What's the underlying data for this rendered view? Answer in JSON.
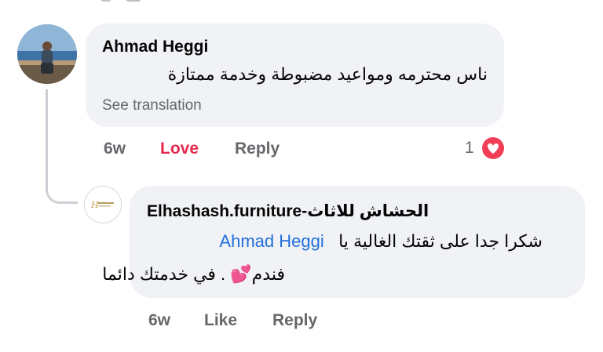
{
  "comments": [
    {
      "author": "Ahmad Heggi",
      "text": "ناس محترمه ومواعيد مضبوطة وخدمة ممتازة",
      "see_translation": "See translation",
      "time": "6w",
      "reaction_label": "Love",
      "reply_label": "Reply",
      "reaction_count": "1",
      "reaction_icon": "heart-reaction-icon",
      "avatar_icon": "profile-photo"
    },
    {
      "author": "Elhashash.furniture-الحشاش للاثاث",
      "text_prefix": "شكرا جدا على ثقتك الغالية يا",
      "mention": "Ahmad Heggi",
      "text_line2": "فندم💕 . في خدمتك دائما",
      "time": "6w",
      "like_label": "Like",
      "reply_label": "Reply",
      "avatar_icon": "brand-logo"
    }
  ],
  "colors": {
    "bubble": "#f0f2f5",
    "meta": "#65676b",
    "love": "#e4294e",
    "mention": "#216fdb",
    "heart": "#f33e58"
  }
}
